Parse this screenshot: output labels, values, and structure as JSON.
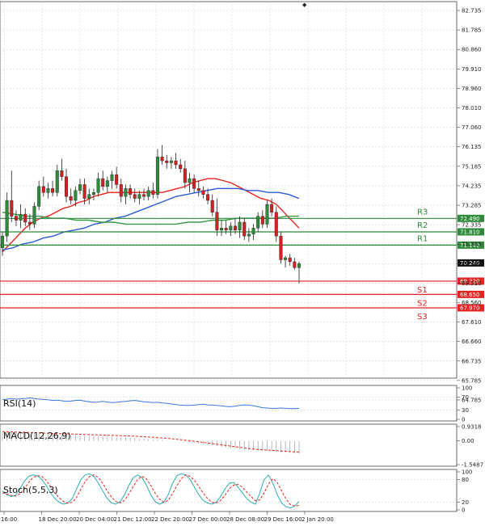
{
  "chart_data": {
    "type": "candlestick",
    "price_axis": {
      "ticks": [
        "82.735",
        "81.785",
        "80.860",
        "79.910",
        "78.960",
        "78.010",
        "77.060",
        "76.135",
        "75.185",
        "74.235",
        "73.285",
        "72.335",
        "71.385",
        "70.460",
        "69.510",
        "68.560",
        "67.610",
        "66.660",
        "66.735",
        "65.785",
        "64.785"
      ],
      "ylim": [
        64.5,
        83.2
      ]
    },
    "time_axis": {
      "ticks": [
        "16:00",
        "18 Dec 20:00",
        "20 Dec 04:00",
        "21 Dec 12:00",
        "22 Dec 20:00",
        "27 Dec 00:00",
        "28 Dec 08:00",
        "29 Dec 16:00",
        "2 Jan 20:00"
      ]
    },
    "candles": [
      {
        "o": 71.0,
        "h": 71.8,
        "l": 70.6,
        "c": 71.6
      },
      {
        "o": 71.6,
        "h": 73.8,
        "l": 71.3,
        "c": 73.4
      },
      {
        "o": 73.4,
        "h": 74.9,
        "l": 72.3,
        "c": 72.6
      },
      {
        "o": 72.6,
        "h": 72.9,
        "l": 72.1,
        "c": 72.4
      },
      {
        "o": 72.4,
        "h": 73.2,
        "l": 72.0,
        "c": 72.7
      },
      {
        "o": 72.7,
        "h": 73.0,
        "l": 72.1,
        "c": 72.3
      },
      {
        "o": 72.3,
        "h": 72.7,
        "l": 71.9,
        "c": 72.2
      },
      {
        "o": 72.2,
        "h": 73.3,
        "l": 72.0,
        "c": 73.1
      },
      {
        "o": 73.1,
        "h": 74.4,
        "l": 72.9,
        "c": 74.1
      },
      {
        "o": 74.1,
        "h": 74.6,
        "l": 73.6,
        "c": 73.8
      },
      {
        "o": 73.8,
        "h": 74.3,
        "l": 73.5,
        "c": 74.0
      },
      {
        "o": 74.0,
        "h": 74.4,
        "l": 73.6,
        "c": 73.8
      },
      {
        "o": 73.8,
        "h": 75.2,
        "l": 73.6,
        "c": 74.9
      },
      {
        "o": 74.9,
        "h": 75.5,
        "l": 74.4,
        "c": 74.6
      },
      {
        "o": 74.6,
        "h": 75.0,
        "l": 73.3,
        "c": 73.6
      },
      {
        "o": 73.6,
        "h": 74.0,
        "l": 73.2,
        "c": 73.4
      },
      {
        "o": 73.4,
        "h": 74.1,
        "l": 73.1,
        "c": 73.9
      },
      {
        "o": 73.9,
        "h": 74.5,
        "l": 73.7,
        "c": 74.2
      },
      {
        "o": 74.2,
        "h": 74.5,
        "l": 73.2,
        "c": 73.5
      },
      {
        "o": 73.5,
        "h": 74.0,
        "l": 73.2,
        "c": 73.7
      },
      {
        "o": 73.7,
        "h": 74.0,
        "l": 73.4,
        "c": 73.8
      },
      {
        "o": 73.8,
        "h": 74.8,
        "l": 73.6,
        "c": 74.5
      },
      {
        "o": 74.5,
        "h": 74.9,
        "l": 73.9,
        "c": 74.1
      },
      {
        "o": 74.1,
        "h": 74.6,
        "l": 73.8,
        "c": 74.4
      },
      {
        "o": 74.4,
        "h": 74.9,
        "l": 74.0,
        "c": 74.7
      },
      {
        "o": 74.7,
        "h": 75.1,
        "l": 74.0,
        "c": 74.2
      },
      {
        "o": 74.2,
        "h": 74.5,
        "l": 73.3,
        "c": 73.6
      },
      {
        "o": 73.6,
        "h": 74.2,
        "l": 73.2,
        "c": 74.0
      },
      {
        "o": 74.0,
        "h": 74.2,
        "l": 73.5,
        "c": 73.7
      },
      {
        "o": 73.7,
        "h": 74.0,
        "l": 73.3,
        "c": 73.5
      },
      {
        "o": 73.5,
        "h": 73.9,
        "l": 73.2,
        "c": 73.7
      },
      {
        "o": 73.7,
        "h": 74.0,
        "l": 73.4,
        "c": 73.6
      },
      {
        "o": 73.6,
        "h": 74.1,
        "l": 73.4,
        "c": 73.9
      },
      {
        "o": 73.9,
        "h": 74.3,
        "l": 73.5,
        "c": 73.7
      },
      {
        "o": 73.7,
        "h": 76.0,
        "l": 73.5,
        "c": 75.6
      },
      {
        "o": 75.6,
        "h": 76.2,
        "l": 75.2,
        "c": 75.4
      },
      {
        "o": 75.4,
        "h": 75.7,
        "l": 75.0,
        "c": 75.3
      },
      {
        "o": 75.3,
        "h": 75.6,
        "l": 75.0,
        "c": 75.4
      },
      {
        "o": 75.4,
        "h": 75.8,
        "l": 75.0,
        "c": 75.2
      },
      {
        "o": 75.2,
        "h": 75.5,
        "l": 74.8,
        "c": 75.0
      },
      {
        "o": 75.0,
        "h": 75.4,
        "l": 74.0,
        "c": 74.3
      },
      {
        "o": 74.3,
        "h": 74.8,
        "l": 73.8,
        "c": 74.5
      },
      {
        "o": 74.5,
        "h": 74.7,
        "l": 73.8,
        "c": 74.0
      },
      {
        "o": 74.0,
        "h": 74.4,
        "l": 73.6,
        "c": 73.9
      },
      {
        "o": 73.9,
        "h": 74.1,
        "l": 73.5,
        "c": 73.7
      },
      {
        "o": 73.7,
        "h": 74.0,
        "l": 73.2,
        "c": 73.4
      },
      {
        "o": 73.4,
        "h": 73.7,
        "l": 72.6,
        "c": 72.8
      },
      {
        "o": 72.8,
        "h": 73.5,
        "l": 71.6,
        "c": 71.9
      },
      {
        "o": 71.9,
        "h": 72.4,
        "l": 71.6,
        "c": 72.0
      },
      {
        "o": 72.0,
        "h": 72.4,
        "l": 71.7,
        "c": 71.9
      },
      {
        "o": 71.9,
        "h": 72.3,
        "l": 71.6,
        "c": 72.1
      },
      {
        "o": 72.1,
        "h": 72.5,
        "l": 71.7,
        "c": 71.9
      },
      {
        "o": 71.9,
        "h": 72.6,
        "l": 71.5,
        "c": 72.3
      },
      {
        "o": 72.3,
        "h": 72.5,
        "l": 71.4,
        "c": 71.6
      },
      {
        "o": 71.6,
        "h": 72.0,
        "l": 71.3,
        "c": 71.7
      },
      {
        "o": 71.7,
        "h": 72.2,
        "l": 71.4,
        "c": 72.0
      },
      {
        "o": 72.0,
        "h": 72.8,
        "l": 71.8,
        "c": 72.6
      },
      {
        "o": 72.6,
        "h": 72.9,
        "l": 72.0,
        "c": 72.2
      },
      {
        "o": 72.2,
        "h": 73.4,
        "l": 72.0,
        "c": 73.2
      },
      {
        "o": 73.2,
        "h": 73.5,
        "l": 72.6,
        "c": 72.8
      },
      {
        "o": 72.8,
        "h": 73.1,
        "l": 71.3,
        "c": 71.6
      },
      {
        "o": 71.6,
        "h": 71.8,
        "l": 70.2,
        "c": 70.4
      },
      {
        "o": 70.4,
        "h": 70.6,
        "l": 70.0,
        "c": 70.5
      },
      {
        "o": 70.5,
        "h": 70.7,
        "l": 70.1,
        "c": 70.3
      },
      {
        "o": 70.3,
        "h": 70.5,
        "l": 69.9,
        "c": 70.0
      },
      {
        "o": 70.0,
        "h": 70.3,
        "l": 69.2,
        "c": 70.2
      }
    ],
    "moving_averages": [
      {
        "color": "#e8231a",
        "values": [
          70.8,
          71.2,
          71.6,
          72.0,
          72.3,
          72.5,
          72.6,
          72.8,
          73.0,
          73.1,
          73.3,
          73.4,
          73.6,
          73.7,
          73.8,
          73.8,
          73.8,
          73.8,
          73.8,
          73.8,
          73.8,
          73.8,
          73.9,
          74.0,
          74.1,
          74.3,
          74.4,
          74.5,
          74.5,
          74.4,
          74.3,
          74.1,
          73.9,
          73.7,
          73.5,
          73.4,
          73.2,
          72.8,
          72.4,
          72.0
        ]
      },
      {
        "color": "#2a5bd7",
        "values": [
          70.9,
          71.0,
          71.2,
          71.3,
          71.5,
          71.6,
          71.8,
          71.9,
          72.0,
          72.2,
          72.3,
          72.5,
          72.6,
          72.8,
          73.0,
          73.2,
          73.4,
          73.6,
          73.7,
          73.8,
          73.9,
          74.0,
          74.0,
          74.0,
          73.9,
          73.9,
          73.8,
          73.8,
          73.7,
          73.5
        ]
      },
      {
        "color": "#3a9a4a",
        "values": [
          72.8,
          72.7,
          72.6,
          72.6,
          72.5,
          72.5,
          72.4,
          72.4,
          72.3,
          72.3,
          72.2,
          72.2,
          72.2,
          72.2,
          72.2,
          72.3,
          72.3,
          72.4,
          72.4,
          72.5,
          72.5,
          72.5,
          72.5,
          72.6,
          72.6
        ]
      }
    ],
    "levels": [
      {
        "name": "R3",
        "value": 72.49,
        "label": "72.490",
        "color": "#2e8b3a"
      },
      {
        "name": "R2",
        "value": 71.81,
        "label": "71.810",
        "color": "#2e8b3a"
      },
      {
        "name": "R1",
        "value": 71.14,
        "label": "71.140",
        "color": "#2e8b3a"
      },
      {
        "name": "S1",
        "value": 69.32,
        "label": "69.320",
        "color": "#e52222"
      },
      {
        "name": "S2",
        "value": 68.65,
        "label": "68.650",
        "color": "#e52222"
      },
      {
        "name": "S3",
        "value": 67.97,
        "label": "67.970",
        "color": "#e52222"
      }
    ],
    "last_price": {
      "value": 70.24,
      "label": "70.240"
    },
    "indicators": {
      "rsi": {
        "title": "RSI(14)",
        "ticks": [
          "100",
          "70",
          "30",
          "0"
        ],
        "ylim": [
          0,
          100
        ],
        "color": "#3a78d8",
        "values": [
          62,
          64,
          66,
          64,
          65,
          66,
          68,
          66,
          64,
          63,
          62,
          60,
          61,
          59,
          57,
          58,
          60,
          61,
          58,
          56,
          54,
          55,
          57,
          55,
          53,
          54,
          56,
          57,
          59,
          60,
          58,
          56,
          55,
          53,
          54,
          52,
          51,
          49,
          47,
          45,
          44,
          44,
          45,
          47,
          48,
          46,
          45,
          44,
          43,
          41,
          40,
          42,
          44,
          46,
          45,
          43,
          40,
          37,
          36,
          35,
          35,
          36,
          35,
          34,
          34,
          35
        ]
      },
      "macd": {
        "title": "MACD(12,26,9)",
        "ticks": [
          "0.9318",
          "0.00",
          "-1.5487"
        ],
        "ylim": [
          -1.5487,
          0.9318
        ],
        "signal_color": "#e8231a",
        "hist": [
          0.55,
          0.58,
          0.56,
          0.55,
          0.54,
          0.52,
          0.5,
          0.49,
          0.47,
          0.46,
          0.45,
          0.43,
          0.42,
          0.4,
          0.38,
          0.37,
          0.36,
          0.35,
          0.33,
          0.32,
          0.3,
          0.3,
          0.29,
          0.28,
          0.27,
          0.25,
          0.24,
          0.22,
          0.2,
          0.18,
          0.16,
          0.14,
          0.12,
          0.1,
          0.08,
          0.06,
          0.04,
          0.02,
          0.0,
          -0.03,
          -0.06,
          -0.1,
          -0.14,
          -0.18,
          -0.22,
          -0.26,
          -0.3,
          -0.34,
          -0.38,
          -0.42,
          -0.46,
          -0.5,
          -0.53,
          -0.56,
          -0.58,
          -0.6,
          -0.62,
          -0.64,
          -0.66,
          -0.68,
          -0.7,
          -0.73,
          -0.76,
          -0.78,
          -0.8,
          -0.82
        ],
        "signal": [
          0.6,
          0.6,
          0.59,
          0.58,
          0.57,
          0.56,
          0.55,
          0.54,
          0.52,
          0.51,
          0.5,
          0.49,
          0.48,
          0.47,
          0.46,
          0.45,
          0.44,
          0.43,
          0.42,
          0.41,
          0.4,
          0.39,
          0.38,
          0.37,
          0.36,
          0.35,
          0.34,
          0.33,
          0.32,
          0.31,
          0.29,
          0.27,
          0.25,
          0.23,
          0.21,
          0.19,
          0.17,
          0.14,
          0.11,
          0.08,
          0.05,
          0.02,
          -0.02,
          -0.06,
          -0.1,
          -0.14,
          -0.18,
          -0.22,
          -0.26,
          -0.3,
          -0.34,
          -0.38,
          -0.42,
          -0.46,
          -0.5,
          -0.53,
          -0.56,
          -0.58,
          -0.6,
          -0.62,
          -0.64,
          -0.66,
          -0.68,
          -0.7,
          -0.72,
          -0.74
        ]
      },
      "stoch": {
        "title": "Stoch(5,5,3)",
        "ticks": [
          "100",
          "80",
          "20",
          "0"
        ],
        "ylim": [
          0,
          100
        ],
        "k_color": "#2bb0b0",
        "d_color": "#e8231a",
        "k": [
          50,
          40,
          35,
          38,
          55,
          75,
          88,
          92,
          90,
          80,
          65,
          45,
          30,
          20,
          15,
          18,
          30,
          55,
          80,
          92,
          95,
          88,
          70,
          50,
          30,
          18,
          15,
          22,
          40,
          65,
          85,
          92,
          85,
          65,
          40,
          22,
          15,
          20,
          40,
          70,
          90,
          95,
          92,
          80,
          60,
          40,
          25,
          18,
          15,
          20,
          35,
          55,
          70,
          72,
          60,
          45,
          30,
          20,
          15,
          45,
          80,
          92,
          70,
          40,
          18,
          8,
          5,
          10,
          22
        ],
        "d": [
          45,
          42,
          38,
          36,
          42,
          55,
          72,
          85,
          90,
          88,
          78,
          62,
          45,
          32,
          22,
          17,
          20,
          33,
          55,
          75,
          88,
          92,
          85,
          70,
          50,
          34,
          22,
          18,
          25,
          42,
          62,
          80,
          88,
          82,
          64,
          44,
          28,
          20,
          25,
          43,
          64,
          82,
          92,
          88,
          78,
          62,
          44,
          30,
          20,
          18,
          25,
          38,
          55,
          65,
          67,
          60,
          47,
          35,
          24,
          26,
          45,
          68,
          82,
          72,
          50,
          28,
          14,
          10,
          12
        ]
      }
    }
  }
}
